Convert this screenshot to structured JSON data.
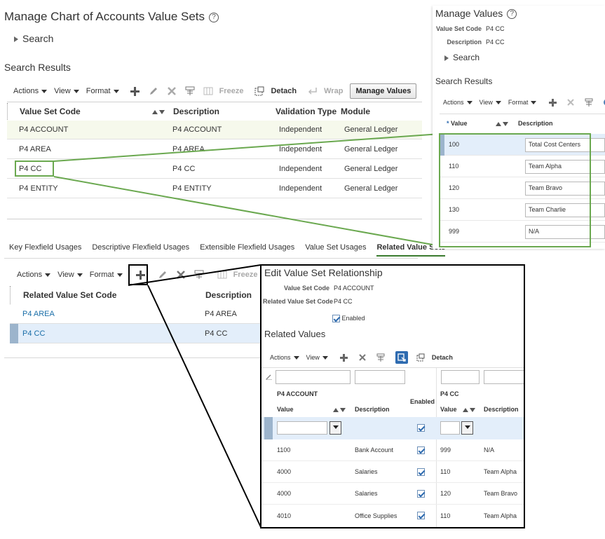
{
  "main": {
    "title": "Manage Chart of Accounts Value Sets",
    "search_label": "Search",
    "results_title": "Search Results",
    "toolbar": {
      "actions": "Actions",
      "view": "View",
      "format": "Format",
      "freeze": "Freeze",
      "detach": "Detach",
      "wrap": "Wrap",
      "manage_values": "Manage Values"
    },
    "columns": [
      "Value Set Code",
      "Description",
      "Validation Type",
      "Module"
    ],
    "rows": [
      {
        "code": "P4 ACCOUNT",
        "description": "P4 ACCOUNT",
        "type": "Independent",
        "module": "General Ledger"
      },
      {
        "code": "P4 AREA",
        "description": "P4 AREA",
        "type": "Independent",
        "module": "General Ledger"
      },
      {
        "code": "P4 CC",
        "description": "P4 CC",
        "type": "Independent",
        "module": "General Ledger"
      },
      {
        "code": "P4 ENTITY",
        "description": "P4 ENTITY",
        "type": "Independent",
        "module": "General Ledger"
      }
    ]
  },
  "tabs": [
    "Key Flexfield Usages",
    "Descriptive Flexfield Usages",
    "Extensible Flexfield Usages",
    "Value Set Usages",
    "Related Value Sets"
  ],
  "related": {
    "toolbar": {
      "actions": "Actions",
      "view": "View",
      "format": "Format",
      "freeze": "Freeze"
    },
    "columns": [
      "Related Value Set Code",
      "Description"
    ],
    "rows": [
      {
        "code": "P4 AREA",
        "description": "P4 AREA"
      },
      {
        "code": "P4 CC",
        "description": "P4 CC"
      }
    ]
  },
  "manage_values": {
    "title": "Manage Values",
    "value_set_code_label": "Value Set Code",
    "value_set_code": "P4 CC",
    "description_label": "Description",
    "description": "P4 CC",
    "search_label": "Search",
    "results_title": "Search Results",
    "toolbar": {
      "actions": "Actions",
      "view": "View",
      "format": "Format"
    },
    "columns": [
      "Value",
      "Description"
    ],
    "required_mark": "*",
    "rows": [
      {
        "value": "100",
        "description": "Total Cost Centers"
      },
      {
        "value": "110",
        "description": "Team Alpha"
      },
      {
        "value": "120",
        "description": "Team Bravo"
      },
      {
        "value": "130",
        "description": "Team Charlie"
      },
      {
        "value": "999",
        "description": "N/A"
      }
    ]
  },
  "edit_relationship": {
    "title": "Edit Value Set Relationship",
    "value_set_code_label": "Value Set Code",
    "value_set_code": "P4 ACCOUNT",
    "related_label": "Related Value Set Code",
    "related_code": "P4 CC",
    "enabled_label": "Enabled",
    "related_values_title": "Related Values",
    "toolbar": {
      "actions": "Actions",
      "view": "View",
      "detach": "Detach"
    },
    "group1": "P4 ACCOUNT",
    "group2": "P4 CC",
    "col_value": "Value",
    "col_description": "Description",
    "col_enabled": "Enabled",
    "rows": [
      {
        "v1": "1100",
        "d1": "Bank Account",
        "v2": "999",
        "d2": "N/A"
      },
      {
        "v1": "4000",
        "d1": "Salaries",
        "v2": "110",
        "d2": "Team Alpha"
      },
      {
        "v1": "4000",
        "d1": "Salaries",
        "v2": "120",
        "d2": "Team Bravo"
      },
      {
        "v1": "4010",
        "d1": "Office Supplies",
        "v2": "110",
        "d2": "Team Alpha"
      }
    ]
  },
  "colors": {
    "highlight_green": "#6aa84f",
    "selected_row": "#e3eefa",
    "hover_row": "#f6f9ec",
    "link": "#1a6ea8"
  }
}
